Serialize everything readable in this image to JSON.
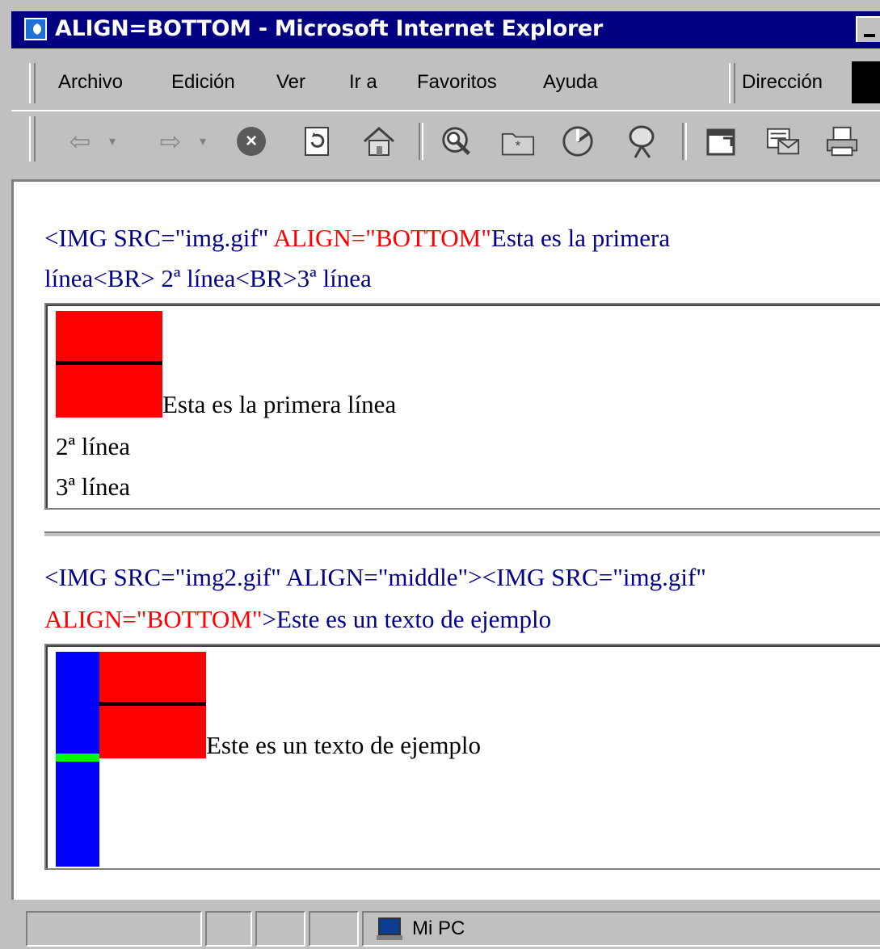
{
  "window": {
    "title": "ALIGN=BOTTOM - Microsoft Internet Explorer"
  },
  "menu": {
    "items": [
      {
        "label": "Archivo"
      },
      {
        "label": "Edición"
      },
      {
        "label": "Ver"
      },
      {
        "label": "Ir a"
      },
      {
        "label": "Favoritos"
      },
      {
        "label": "Ayuda"
      }
    ],
    "address_label": "Dirección"
  },
  "toolbar": {
    "icons": [
      "back-icon",
      "forward-icon",
      "stop-icon",
      "refresh-icon",
      "home-icon",
      "search-icon",
      "favorites-icon",
      "history-icon",
      "channels-icon",
      "fullscreen-icon",
      "mail-icon",
      "print-icon"
    ]
  },
  "content": {
    "example1": {
      "code_part1": "<IMG SRC=\"img.gif\" ",
      "code_red": "ALIGN=\"BOTTOM\"",
      "code_part2": "Esta es la primera",
      "code_line2": "línea<BR> 2ª línea<BR>3ª línea",
      "render_line1": "Esta es la primera línea",
      "render_line2": "2ª línea",
      "render_line3": "3ª línea"
    },
    "example2": {
      "code_line1": "<IMG SRC=\"img2.gif\" ALIGN=\"middle\"><IMG SRC=\"img.gif\"",
      "code_red": "ALIGN=\"BOTTOM\"",
      "code_line2_rest": ">Este es un texto de ejemplo",
      "render_text": "Este es un texto de ejemplo"
    }
  },
  "statusbar": {
    "zone_label": "Mi PC"
  }
}
